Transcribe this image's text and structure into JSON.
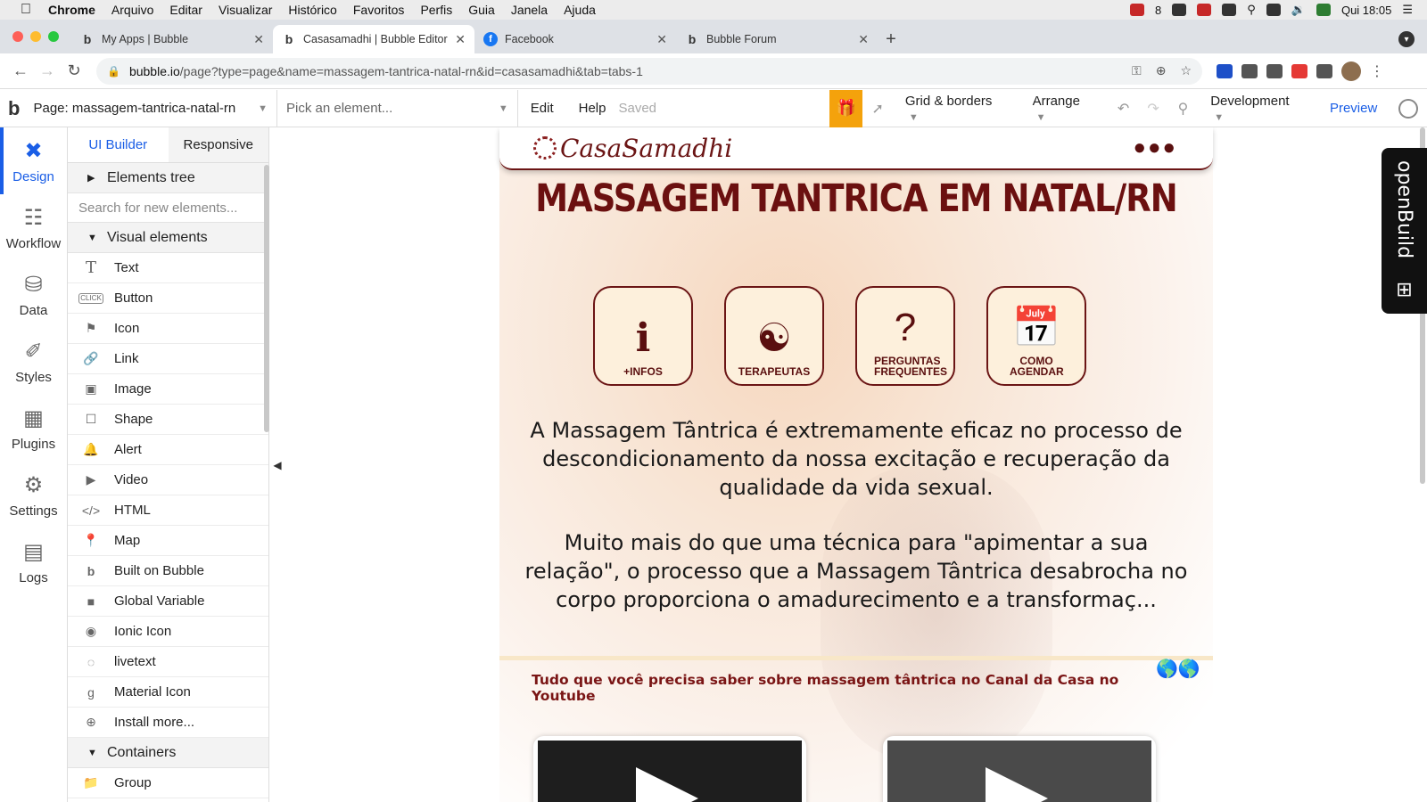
{
  "os_menu": {
    "app": "Chrome",
    "items": [
      "Arquivo",
      "Editar",
      "Visualizar",
      "Histórico",
      "Favoritos",
      "Perfis",
      "Guia",
      "Janela",
      "Ajuda"
    ],
    "status_count": "8",
    "clock": "Qui 18:05"
  },
  "tabs": [
    {
      "title": "My Apps | Bubble",
      "favicon": "bubble-icon"
    },
    {
      "title": "Casasamadhi | Bubble Editor",
      "favicon": "bubble-icon",
      "active": true
    },
    {
      "title": "Facebook",
      "favicon": "facebook-icon"
    },
    {
      "title": "Bubble Forum",
      "favicon": "bubble-icon"
    }
  ],
  "address": {
    "host": "bubble.io",
    "path": "/page?type=page&name=massagem-tantrica-natal-rn&id=casasamadhi&tab=tabs-1"
  },
  "toolbar": {
    "page_label": "Page: massagem-tantrica-natal-rn",
    "element_picker": "Pick an element...",
    "edit": "Edit",
    "help": "Help",
    "saved": "Saved",
    "grid": "Grid & borders",
    "arrange": "Arrange",
    "development": "Development",
    "preview": "Preview"
  },
  "rail": [
    {
      "label": "Design",
      "icon": "design-icon",
      "active": true
    },
    {
      "label": "Workflow",
      "icon": "workflow-icon"
    },
    {
      "label": "Data",
      "icon": "database-icon"
    },
    {
      "label": "Styles",
      "icon": "brush-icon"
    },
    {
      "label": "Plugins",
      "icon": "plugins-icon"
    },
    {
      "label": "Settings",
      "icon": "gear-icon"
    },
    {
      "label": "Logs",
      "icon": "logs-icon"
    }
  ],
  "panel": {
    "tab_ui": "UI Builder",
    "tab_responsive": "Responsive",
    "elements_tree": "Elements tree",
    "search_placeholder": "Search for new elements...",
    "visual_elements": "Visual elements",
    "items": [
      {
        "label": "Text",
        "icon": "text-icon"
      },
      {
        "label": "Button",
        "icon": "button-icon"
      },
      {
        "label": "Icon",
        "icon": "flag-icon"
      },
      {
        "label": "Link",
        "icon": "link-icon"
      },
      {
        "label": "Image",
        "icon": "image-icon"
      },
      {
        "label": "Shape",
        "icon": "shape-icon"
      },
      {
        "label": "Alert",
        "icon": "bell-icon"
      },
      {
        "label": "Video",
        "icon": "video-icon"
      },
      {
        "label": "HTML",
        "icon": "code-icon"
      },
      {
        "label": "Map",
        "icon": "map-pin-icon"
      },
      {
        "label": "Built on Bubble",
        "icon": "bubble-icon"
      },
      {
        "label": "Global Variable",
        "icon": "square-icon"
      },
      {
        "label": "Ionic Icon",
        "icon": "radio-icon"
      },
      {
        "label": "livetext",
        "icon": "dashed-circle-icon"
      },
      {
        "label": "Material Icon",
        "icon": "material-icon"
      },
      {
        "label": "Install more...",
        "icon": "plus-circle-icon"
      }
    ],
    "containers": "Containers",
    "group": "Group"
  },
  "canvas": {
    "logo_text": "CasaSamadhi",
    "headline": "MASSAGEM TANTRICA EM NATAL/RN",
    "buttons": [
      {
        "label": "+INFOS",
        "icon": "info-icon"
      },
      {
        "label": "TERAPEUTAS",
        "icon": "meditation-icon"
      },
      {
        "label": "PERGUNTAS FREQUENTES",
        "icon": "question-icon"
      },
      {
        "label": "COMO AGENDAR",
        "icon": "calendar-icon"
      }
    ],
    "para1": "A Massagem Tântrica é extremamente eficaz no processo de descondicionamento da nossa excitação e recuperação da qualidade da vida sexual.",
    "para2": "Muito mais do que uma técnica para \"apimentar a sua relação\", o processo que a Massagem Tântrica desabrocha no corpo proporciona o amadurecimento e a transformaç...",
    "youtube_line": "Tudo que você precisa saber sobre massagem tântrica no Canal da Casa no Youtube"
  },
  "openbuild": "openBuild",
  "colors": {
    "accent": "#1a5ee6",
    "brand_dark": "#6b1515",
    "gift": "#f4a20c"
  }
}
